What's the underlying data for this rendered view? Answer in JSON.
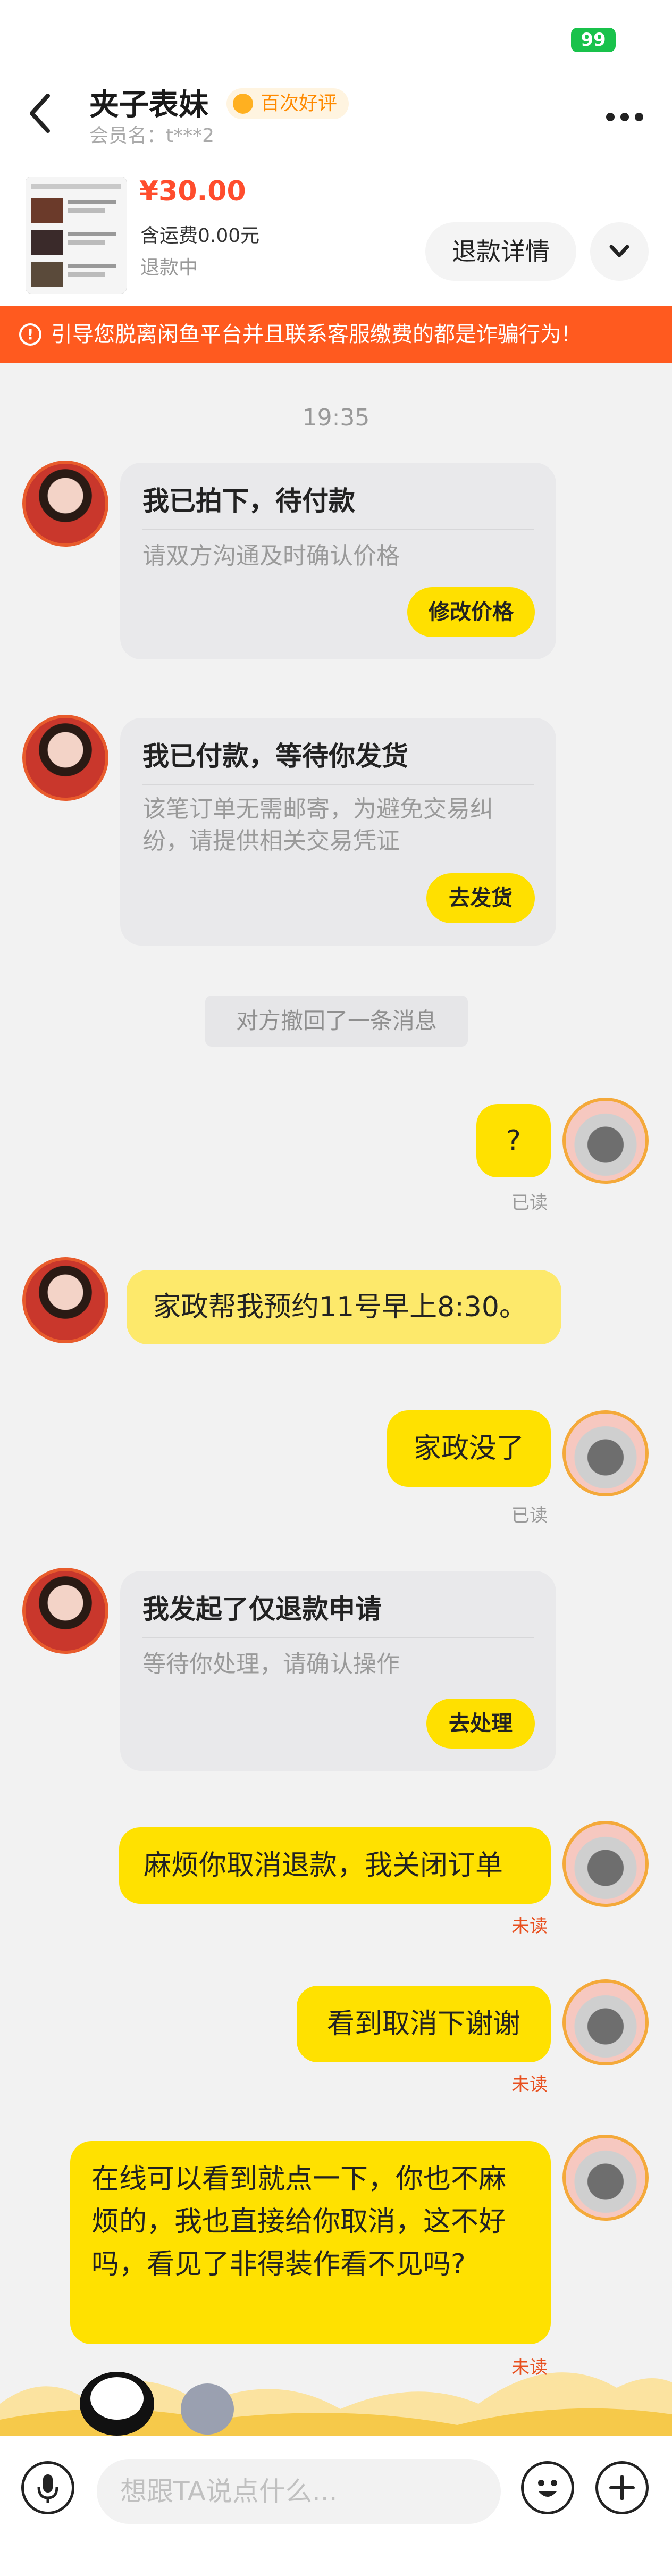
{
  "status": {
    "battery": "99"
  },
  "header": {
    "title": "夹子表妹",
    "badge": "百次好评",
    "member": "会员名：t***2"
  },
  "product": {
    "price": "¥30.00",
    "shipping": "含运费0.00元",
    "status": "退款中",
    "refund_button": "退款详情"
  },
  "warning": {
    "text": "引导您脱离闲鱼平台并且联系客服缴费的都是诈骗行为!"
  },
  "chat": {
    "time": "19:35",
    "card1": {
      "title": "我已拍下，待付款",
      "desc": "请双方沟通及时确认价格",
      "button": "修改价格"
    },
    "card2": {
      "title": "我已付款，等待你发货",
      "desc": "该笔订单无需邮寄，为避免交易纠纷，请提供相关交易凭证",
      "button": "去发货"
    },
    "recall": "对方撤回了一条消息",
    "msg_q": {
      "text": "?",
      "status": "已读"
    },
    "msg_her": {
      "text": "家政帮我预约11号早上8:30。"
    },
    "msg_me1": {
      "text": "家政没了",
      "status": "已读"
    },
    "card3": {
      "title": "我发起了仅退款申请",
      "desc": "等待你处理，请确认操作",
      "button": "去处理"
    },
    "msg_me2": {
      "text": "麻烦你取消退款，我关闭订单",
      "status": "未读"
    },
    "msg_me3": {
      "text": "看到取消下谢谢",
      "status": "未读"
    },
    "msg_me4": {
      "text": "在线可以看到就点一下，你也不麻烦的，我也直接给你取消，这不好吗，看见了非得装作看不见吗?",
      "status": "未读"
    }
  },
  "input": {
    "placeholder": "想跟TA说点什么..."
  },
  "colors": {
    "accent_yellow": "#ffe100",
    "warning_orange": "#ff5a1f",
    "price_red": "#ff4d2d",
    "unread_red": "#e8501f"
  }
}
